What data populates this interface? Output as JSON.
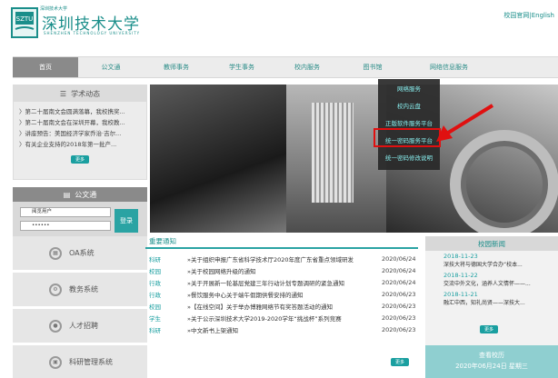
{
  "header": {
    "logo_top": "深圳技术大学",
    "logo_name": "深圳技术大学",
    "logo_en": "SHENZHEN TECHNOLOGY UNIVERSITY",
    "links": "校园官网|English"
  },
  "nav": [
    "首页",
    "公文通",
    "教师事务",
    "学生事务",
    "校内服务",
    "图书馆",
    "网络信息服务"
  ],
  "dropdown": [
    "网络服务",
    "校内云盘",
    "正版软件服务平台",
    "统一密码服务平台",
    "统一密码修改说明"
  ],
  "academic": {
    "title": "学术动态",
    "items": [
      "第二十届南文会圆满落幕，我校携奖...",
      "第二十届南文会在深圳开幕，我校教...",
      "讲座预告：美国经济学家乔治·吉尔...",
      "有关企业支持的2018年第一批产..."
    ],
    "more": "更多"
  },
  "login": {
    "title": "公文通",
    "user_value": "阅览用户",
    "password_value": "••••••",
    "button": "登录"
  },
  "systems": [
    "OA系统",
    "教务系统",
    "人才招聘",
    "科研管理系统"
  ],
  "notices": {
    "title": "重要通知",
    "rows": [
      {
        "cat": "科研",
        "title": "关于组织申报广东省科学技术厅2020年度广东省重点领域研发",
        "date": "2020/06/24"
      },
      {
        "cat": "校园",
        "title": "关于校园网络升级的通知",
        "date": "2020/06/24"
      },
      {
        "cat": "行政",
        "title": "关于开展新一轮基层党建三年行动计划专题调研的紧急通知",
        "date": "2020/06/24"
      },
      {
        "cat": "行政",
        "title": "餐饮服务中心关于端午假期供餐安排的通知",
        "date": "2020/06/23"
      },
      {
        "cat": "校园",
        "title": "【在线空间】关于举办博雅网络节有奖答题活动的通知",
        "date": "2020/06/23"
      },
      {
        "cat": "学生",
        "title": "关于公示深圳技术大学2019-2020学年“挑战杯”系列竞赛",
        "date": "2020/06/23"
      },
      {
        "cat": "科研",
        "title": "中文新书上架通知",
        "date": "2020/06/23"
      }
    ],
    "more": "更多"
  },
  "campus": {
    "title": "校园新闻",
    "items": [
      {
        "date": "2018-11-23",
        "title": "深技大将与德国大学合办“校本..."
      },
      {
        "date": "2018-11-22",
        "title": "交流中外文化，涵养人文情怀——..."
      },
      {
        "date": "2018-11-21",
        "title": "融汇中西，知礼尚贤——深技大..."
      }
    ],
    "more": "更多",
    "calendar_title": "查看校历",
    "calendar_date": "2020年06月24日 星期三"
  }
}
